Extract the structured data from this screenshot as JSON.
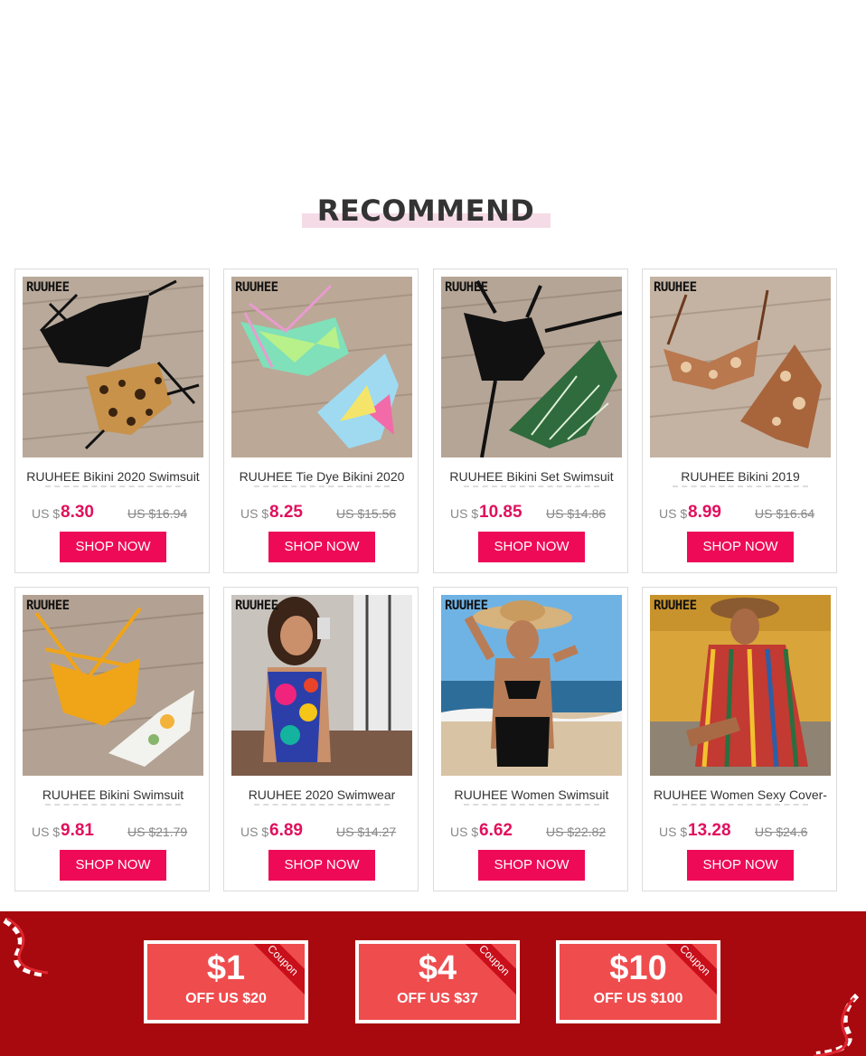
{
  "section": {
    "title": "RECOMMEND"
  },
  "products": [
    {
      "brand": "RUUHEE",
      "name": "RUUHEE Bikini 2020 Swimsuit",
      "currency": "US $",
      "price": "8.30",
      "old_price": "US $16.94",
      "cta": "SHOP NOW"
    },
    {
      "brand": "RUUHEE",
      "name": "RUUHEE Tie Dye Bikini 2020",
      "currency": "US $",
      "price": "8.25",
      "old_price": "US $15.56",
      "cta": "SHOP NOW"
    },
    {
      "brand": "RUUHEE",
      "name": "RUUHEE Bikini Set Swimsuit",
      "currency": "US $",
      "price": "10.85",
      "old_price": "US $14.86",
      "cta": "SHOP NOW"
    },
    {
      "brand": "RUUHEE",
      "name": "RUUHEE Bikini 2019",
      "currency": "US $",
      "price": "8.99",
      "old_price": "US $16.64",
      "cta": "SHOP NOW"
    },
    {
      "brand": "RUUHEE",
      "name": "RUUHEE Bikini Swimsuit",
      "currency": "US $",
      "price": "9.81",
      "old_price": "US $21.79",
      "cta": "SHOP NOW"
    },
    {
      "brand": "RUUHEE",
      "name": "RUUHEE 2020 Swimwear",
      "currency": "US $",
      "price": "6.89",
      "old_price": "US $14.27",
      "cta": "SHOP NOW"
    },
    {
      "brand": "RUUHEE",
      "name": "RUUHEE Women Swimsuit",
      "currency": "US $",
      "price": "6.62",
      "old_price": "US $22.82",
      "cta": "SHOP NOW"
    },
    {
      "brand": "RUUHEE",
      "name": "RUUHEE Women Sexy Cover-",
      "currency": "US $",
      "price": "13.28",
      "old_price": "US $24.6",
      "cta": "SHOP NOW"
    }
  ],
  "coupons": [
    {
      "amount": "$1",
      "condition": "OFF US $20",
      "tag": "Coupon"
    },
    {
      "amount": "$4",
      "condition": "OFF US $37",
      "tag": "Coupon"
    },
    {
      "amount": "$10",
      "condition": "OFF US $100",
      "tag": "Coupon"
    }
  ],
  "colors": {
    "accent": "#ee0a56",
    "price": "#e0105c",
    "band": "#a8090e",
    "coupon": "#ef4c4e",
    "title_underline": "#f5dbe6"
  }
}
